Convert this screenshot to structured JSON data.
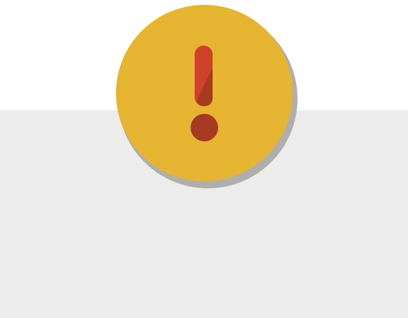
{
  "theme": {
    "top_background": "#ffffff",
    "bottom_background": "#ececec",
    "badge_color": "#e5b532",
    "badge_shadow_color": "#b0aeab",
    "exclamation_color": "#cd4228",
    "exclamation_shade_color": "#a63a23"
  },
  "icon": {
    "name": "exclamation-warning-icon"
  }
}
